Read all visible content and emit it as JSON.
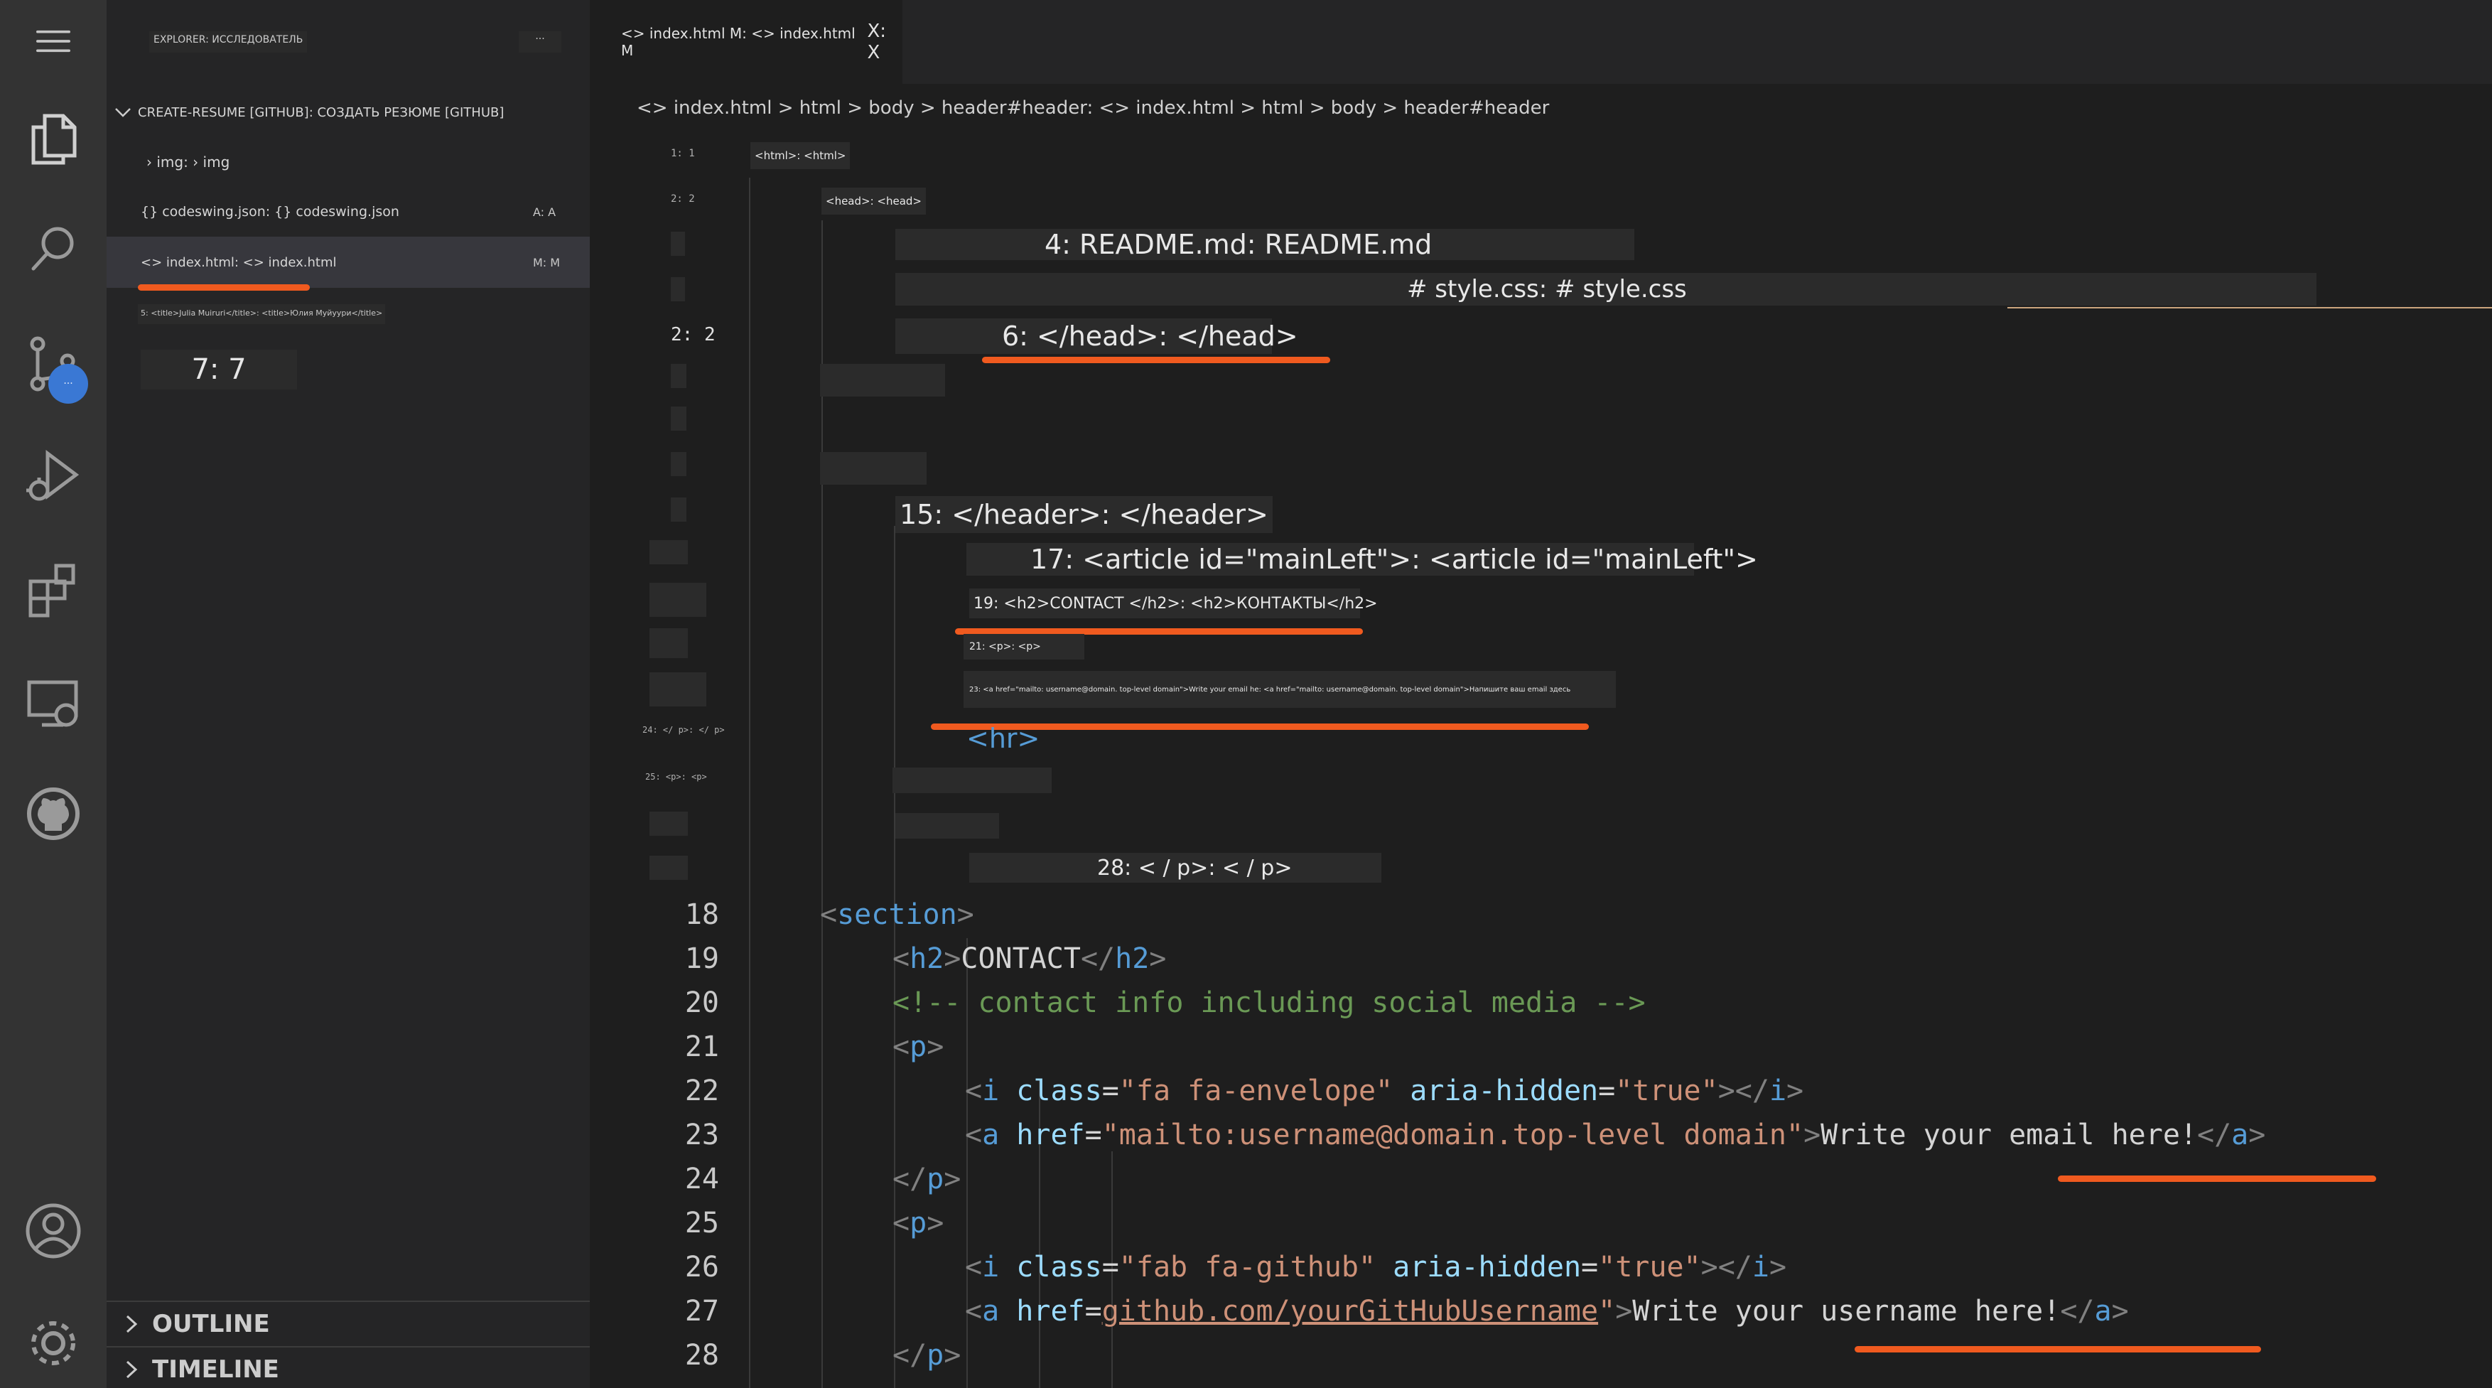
{
  "activity_bar": {
    "menu_icon": "hamburger-menu-icon",
    "items": [
      {
        "icon": "explorer-files-icon"
      },
      {
        "icon": "search-icon"
      },
      {
        "icon": "source-control-icon"
      },
      {
        "icon": "run-debug-icon"
      },
      {
        "icon": "extensions-icon"
      },
      {
        "icon": "remote-explorer-icon"
      },
      {
        "icon": "github-icon"
      }
    ],
    "account_icon": "account-icon",
    "settings_icon": "gear-icon",
    "badge_text": "···"
  },
  "sidebar": {
    "title": "EXPLORER: ИССЛЕДОВАТЕЛЬ",
    "more_label": "···",
    "project": "CREATE-RESUME [GITHUB]: СОЗДАТЬ РЕЗЮМЕ [GITHUB]",
    "files": [
      {
        "label": "› img: › img",
        "decoration": ""
      },
      {
        "label": "{} codeswing.json: {} codeswing.json",
        "decoration": "A: A"
      },
      {
        "label": "<> index.html: <> index.html",
        "decoration": "M: M"
      }
    ],
    "small_item": "5: <title>Julia Muiruri</title>: <title>Юлия Муйуури</title>",
    "chip": "7: 7",
    "sections": [
      "OUTLINE",
      "TIMELINE"
    ]
  },
  "editor": {
    "tab": {
      "name": "<> index.html M: <> index.html M",
      "close": "X: X"
    },
    "breadcrumb": "<> index.html > html > body > header#header: <> index.html > html > body > header#header",
    "gutter_labels": [
      "1: 1",
      "2: 2",
      "2: 2",
      "24: </ p>: </ p>",
      "25: <p>: <p>"
    ],
    "overlays": {
      "html": "<html>: <html>",
      "head": "<head>: <head>",
      "readme": "4: README.md: README.md",
      "style": "# style.css: # style.css",
      "head_close": "6: </head>: </head>",
      "header_close": "15: </header>: </header>",
      "article": "17: <article id=\"mainLeft\">: <article id=\"mainLeft\">",
      "h2": "19: <h2>CONTACT </h2>: <h2>КОНТАКТЫ</h2>",
      "p": "21: <p>: <p>",
      "a_line": "23: <a href=\"mailto: username@domain. top-level domain\">Write your email he: <a href=\"mailto: username@domain. top-level domain\">Напишите ваш email здесь",
      "hr": "<hr>",
      "p_close": "28: < / p>: < / p>"
    },
    "code_lines": [
      {
        "n": "18",
        "indent": 2,
        "parts": [
          [
            "br",
            "<"
          ],
          [
            "tag",
            "section"
          ],
          [
            "br",
            ">"
          ]
        ]
      },
      {
        "n": "19",
        "indent": 3,
        "parts": [
          [
            "br",
            "<"
          ],
          [
            "tag",
            "h2"
          ],
          [
            "br",
            ">"
          ],
          [
            "txt",
            "CONTACT"
          ],
          [
            "br",
            "</"
          ],
          [
            "tag",
            "h2"
          ],
          [
            "br",
            ">"
          ]
        ]
      },
      {
        "n": "20",
        "indent": 3,
        "parts": [
          [
            "cmt",
            "<!-- contact info including social media -->"
          ]
        ]
      },
      {
        "n": "21",
        "indent": 3,
        "parts": [
          [
            "br",
            "<"
          ],
          [
            "tag",
            "p"
          ],
          [
            "br",
            ">"
          ]
        ]
      },
      {
        "n": "22",
        "indent": 4,
        "parts": [
          [
            "br",
            "<"
          ],
          [
            "tag",
            "i"
          ],
          [
            "txt",
            " "
          ],
          [
            "attr",
            "class"
          ],
          [
            "txt",
            "="
          ],
          [
            "str",
            "\"fa fa-envelope\""
          ],
          [
            "txt",
            " "
          ],
          [
            "attr",
            "aria-hidden"
          ],
          [
            "txt",
            "="
          ],
          [
            "str",
            "\"true\""
          ],
          [
            "br",
            "></"
          ],
          [
            "tag",
            "i"
          ],
          [
            "br",
            ">"
          ]
        ]
      },
      {
        "n": "23",
        "indent": 4,
        "parts": [
          [
            "br",
            "<"
          ],
          [
            "tag",
            "a"
          ],
          [
            "txt",
            " "
          ],
          [
            "attr",
            "href"
          ],
          [
            "txt",
            "="
          ],
          [
            "str",
            "\"mailto:username@domain.top-level domain\""
          ],
          [
            "br",
            ">"
          ],
          [
            "txt",
            "Write your email here!"
          ],
          [
            "br",
            "</"
          ],
          [
            "tag",
            "a"
          ],
          [
            "br",
            ">"
          ]
        ]
      },
      {
        "n": "24",
        "indent": 3,
        "parts": [
          [
            "br",
            "</"
          ],
          [
            "tag",
            "p"
          ],
          [
            "br",
            ">"
          ]
        ]
      },
      {
        "n": "25",
        "indent": 3,
        "parts": [
          [
            "br",
            "<"
          ],
          [
            "tag",
            "p"
          ],
          [
            "br",
            ">"
          ]
        ]
      },
      {
        "n": "26",
        "indent": 4,
        "parts": [
          [
            "br",
            "<"
          ],
          [
            "tag",
            "i"
          ],
          [
            "txt",
            " "
          ],
          [
            "attr",
            "class"
          ],
          [
            "txt",
            "="
          ],
          [
            "str",
            "\"fab fa-github\""
          ],
          [
            "txt",
            " "
          ],
          [
            "attr",
            "aria-hidden"
          ],
          [
            "txt",
            "="
          ],
          [
            "str",
            "\"true\""
          ],
          [
            "br",
            "></"
          ],
          [
            "tag",
            "i"
          ],
          [
            "br",
            ">"
          ]
        ]
      },
      {
        "n": "27",
        "indent": 4,
        "parts": [
          [
            "br",
            "<"
          ],
          [
            "tag",
            "a"
          ],
          [
            "txt",
            " "
          ],
          [
            "attr",
            "href"
          ],
          [
            "txt",
            "="
          ],
          [
            "link",
            "github.com/yourGitHubUsername"
          ],
          [
            "str",
            "\""
          ],
          [
            "br",
            ">"
          ],
          [
            "txt",
            "Write your username here!"
          ],
          [
            "br",
            "</"
          ],
          [
            "tag",
            "a"
          ],
          [
            "br",
            ">"
          ]
        ]
      },
      {
        "n": "28",
        "indent": 3,
        "parts": [
          [
            "br",
            "</"
          ],
          [
            "tag",
            "p"
          ],
          [
            "br",
            ">"
          ]
        ]
      }
    ]
  },
  "colors": {
    "accent_underline": "#f05a1f",
    "badge": "#3a78d4",
    "tag": "#569cd6",
    "attribute": "#9cdcfe",
    "string": "#ce9178",
    "comment": "#6a9955"
  }
}
